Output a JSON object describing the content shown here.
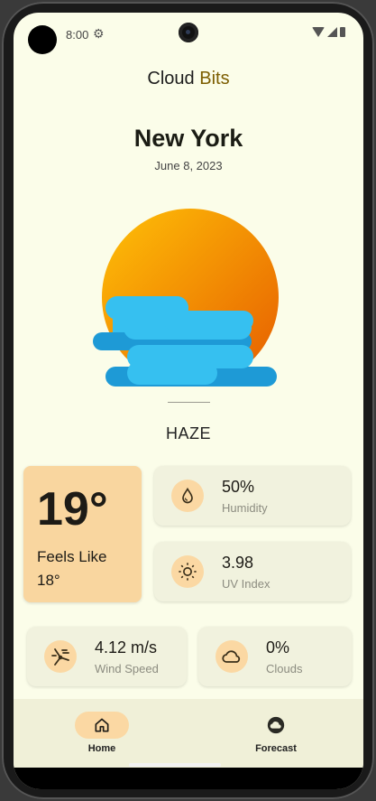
{
  "status": {
    "time": "8:00"
  },
  "app": {
    "title_main": "Cloud",
    "title_accent": "Bits"
  },
  "location": {
    "city": "New York",
    "date": "June 8, 2023"
  },
  "condition": "HAZE",
  "temperature": {
    "value": "19°",
    "feels_label": "Feels Like",
    "feels_value": "18°"
  },
  "stats": {
    "humidity": {
      "value": "50%",
      "label": "Humidity",
      "icon": "water-drop-icon"
    },
    "uv": {
      "value": "3.98",
      "label": "UV Index",
      "icon": "sun-icon"
    },
    "wind": {
      "value": "4.12 m/s",
      "label": "Wind Speed",
      "icon": "wind-icon"
    },
    "clouds": {
      "value": "0%",
      "label": "Clouds",
      "icon": "cloud-icon"
    }
  },
  "nav": {
    "home": {
      "label": "Home",
      "icon": "home-icon"
    },
    "forecast": {
      "label": "Forecast",
      "icon": "forecast-cloud-icon"
    }
  },
  "colors": {
    "background": "#fbfde9",
    "accent": "#7c5d00",
    "temp_card": "#f9d69f",
    "stat_card": "#f1f2de",
    "icon_bg": "#fbd8a3",
    "sun_start": "#ffc107",
    "sun_end": "#e65c00",
    "haze_light": "#36c0f0",
    "haze_dark": "#1e9ad6"
  }
}
